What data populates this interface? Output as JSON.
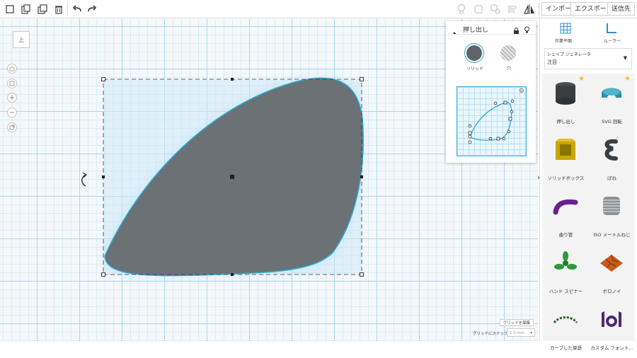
{
  "toolbar": {
    "left_icons": [
      "new-shape-icon",
      "paste-icon",
      "duplicate-icon",
      "delete-icon",
      "undo-icon",
      "redo-icon"
    ],
    "right_icons": [
      "lightbulb-icon",
      "group-icon",
      "ungroup-icon",
      "align-icon",
      "mirror-icon"
    ],
    "import_label": "インポート",
    "export_label": "エクスポート",
    "send_label": "送信先"
  },
  "viewcube": {
    "face_label": "上"
  },
  "nav_icons": [
    "home-icon",
    "fit-view-icon",
    "zoom-in-icon",
    "zoom-out-icon",
    "perspective-icon"
  ],
  "shape_panel": {
    "title": "押し出し",
    "solid_label": "ソリッド",
    "hole_label": "穴",
    "solid_color": "#5e6468",
    "selected": "solid"
  },
  "workspace": {
    "shape_fill": "#6b7175",
    "outline_color": "#2fa7d2",
    "selection_fill": "#cfe9f7",
    "grid_edit_label": "グリッドを編集",
    "snap_label": "グリッドにスナップ",
    "snap_value": "1.0 mm"
  },
  "right_panel": {
    "workplane_label": "作業平面",
    "ruler_label": "ルーラー",
    "generator_header": "シェイプ ジェネレータ",
    "generator_value": "注目",
    "shapes": [
      {
        "label": "押し出し",
        "icon": "extrude-shape-icon",
        "starred": true
      },
      {
        "label": "SVG 回転",
        "icon": "svg-revolve-shape-icon",
        "starred": true
      },
      {
        "label": "ソリッドボックス",
        "icon": "solid-box-shape-icon",
        "starred": false
      },
      {
        "label": "ばね",
        "icon": "spring-shape-icon",
        "starred": false
      },
      {
        "label": "曲り管",
        "icon": "bent-pipe-shape-icon",
        "starred": false
      },
      {
        "label": "ISO メートルねじ",
        "icon": "iso-metric-thread-shape-icon",
        "starred": false
      },
      {
        "label": "ハンド スピナー",
        "icon": "hand-spinner-shape-icon",
        "starred": false
      },
      {
        "label": "ボロノイ",
        "icon": "voronoi-shape-icon",
        "starred": false
      },
      {
        "label": "カーブした単語",
        "icon": "curved-word-shape-icon",
        "starred": false
      },
      {
        "label": "カスタム フォント...",
        "icon": "custom-font-shape-icon",
        "starred": false
      }
    ]
  }
}
